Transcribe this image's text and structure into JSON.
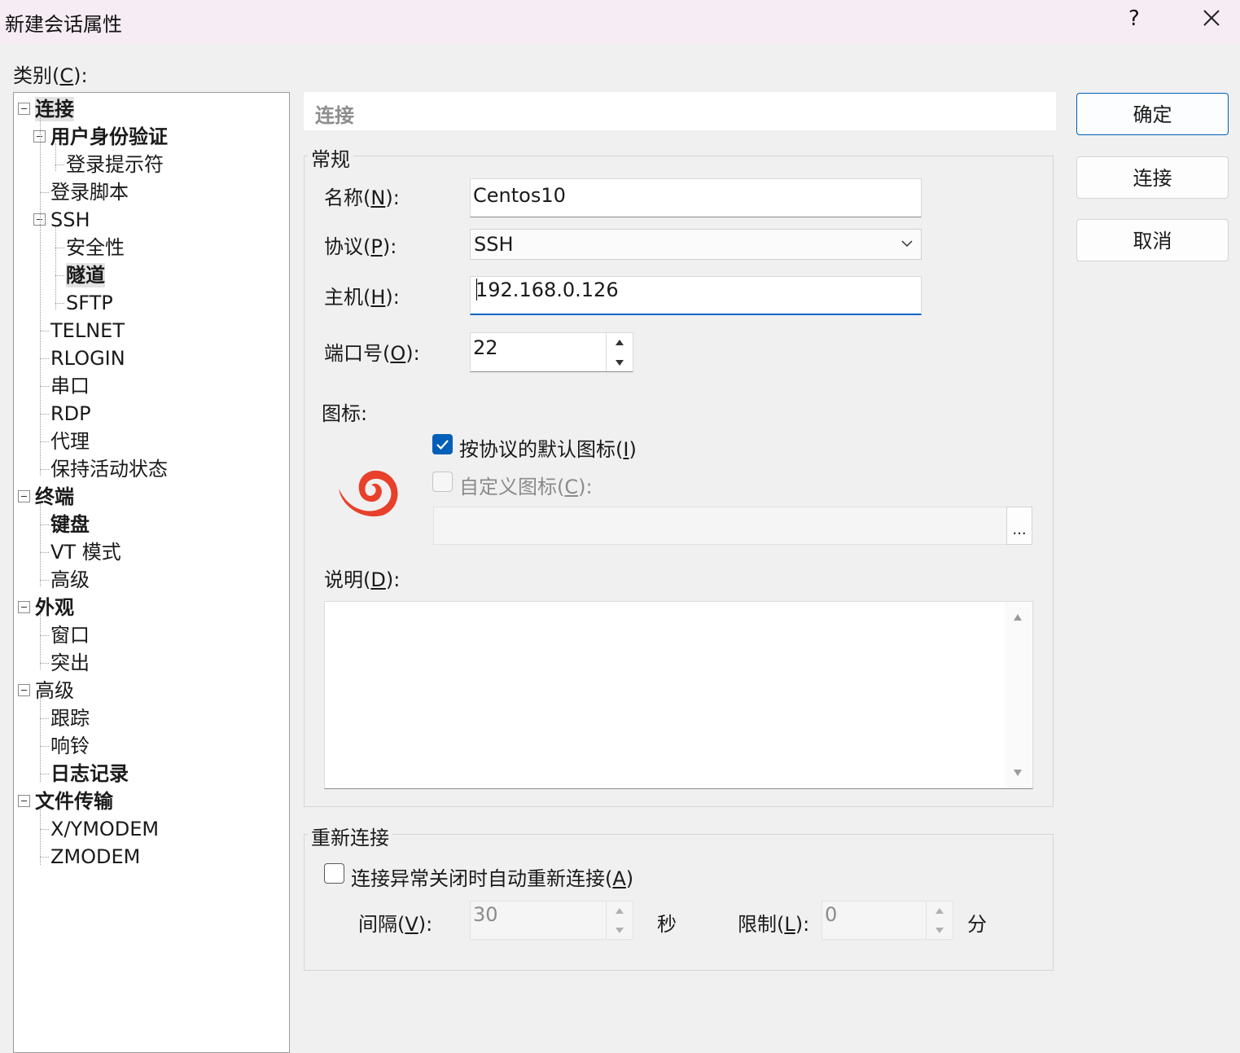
{
  "window": {
    "title": "新建会话属性",
    "help_label": "?",
    "close_icon": "close-icon"
  },
  "category_label": "类别(C):",
  "tree": [
    {
      "label": "连接",
      "level": 0,
      "bold": true,
      "expander": true,
      "selected": true
    },
    {
      "label": "用户身份验证",
      "level": 1,
      "bold": true,
      "expander": true
    },
    {
      "label": "登录提示符",
      "level": 2,
      "bold": false
    },
    {
      "label": "登录脚本",
      "level": 1,
      "bold": false
    },
    {
      "label": "SSH",
      "level": 1,
      "bold": false,
      "expander": true
    },
    {
      "label": "安全性",
      "level": 2,
      "bold": false
    },
    {
      "label": "隧道",
      "level": 2,
      "bold": true,
      "selected": true
    },
    {
      "label": "SFTP",
      "level": 2,
      "bold": false
    },
    {
      "label": "TELNET",
      "level": 1,
      "bold": false
    },
    {
      "label": "RLOGIN",
      "level": 1,
      "bold": false
    },
    {
      "label": "串口",
      "level": 1,
      "bold": false
    },
    {
      "label": "RDP",
      "level": 1,
      "bold": false
    },
    {
      "label": "代理",
      "level": 1,
      "bold": false
    },
    {
      "label": "保持活动状态",
      "level": 1,
      "bold": false
    },
    {
      "label": "终端",
      "level": 0,
      "bold": true,
      "expander": true
    },
    {
      "label": "键盘",
      "level": 1,
      "bold": true
    },
    {
      "label": "VT 模式",
      "level": 1,
      "bold": false
    },
    {
      "label": "高级",
      "level": 1,
      "bold": false
    },
    {
      "label": "外观",
      "level": 0,
      "bold": true,
      "expander": true
    },
    {
      "label": "窗口",
      "level": 1,
      "bold": false
    },
    {
      "label": "突出",
      "level": 1,
      "bold": false
    },
    {
      "label": "高级",
      "level": 0,
      "bold": false,
      "expander": true
    },
    {
      "label": "跟踪",
      "level": 1,
      "bold": false
    },
    {
      "label": "响铃",
      "level": 1,
      "bold": false
    },
    {
      "label": "日志记录",
      "level": 1,
      "bold": true
    },
    {
      "label": "文件传输",
      "level": 0,
      "bold": true,
      "expander": true
    },
    {
      "label": "X/YMODEM",
      "level": 1,
      "bold": false
    },
    {
      "label": "ZMODEM",
      "level": 1,
      "bold": false
    }
  ],
  "section_header": "连接",
  "general": {
    "group_title": "常规",
    "name_label": "名称(",
    "name_key": "N",
    "name_value": "Centos10",
    "protocol_label": "协议(",
    "protocol_key": "P",
    "protocol_value": "SSH",
    "host_label": "主机(",
    "host_key": "H",
    "host_value": "192.168.0.126",
    "port_label": "端口号(",
    "port_key": "O",
    "port_value": "22",
    "icon_label": "图标:",
    "default_icon_checkbox": "按协议的默认图标(",
    "default_icon_key": "I",
    "default_icon_checked": true,
    "custom_icon_checkbox": "自定义图标(",
    "custom_icon_key": "C",
    "custom_icon_checked": false,
    "browse_label": "...",
    "desc_label": "说明(",
    "desc_key": "D",
    "desc_value": "",
    "protocol_icon": "spiral-app-icon",
    "accent_color": "#e8402a"
  },
  "reconnect": {
    "group_title": "重新连接",
    "auto_checkbox": "连接异常关闭时自动重新连接(",
    "auto_key": "A",
    "auto_checked": false,
    "interval_label": "间隔(",
    "interval_key": "V",
    "interval_value": "30",
    "interval_unit": "秒",
    "limit_label": "限制(",
    "limit_key": "L",
    "limit_value": "0",
    "limit_unit": "分"
  },
  "buttons": {
    "ok": "确定",
    "connect": "连接",
    "cancel": "取消"
  },
  "colors": {
    "primary_blue": "#005fb8",
    "title_bg": "#f6ecf4"
  }
}
